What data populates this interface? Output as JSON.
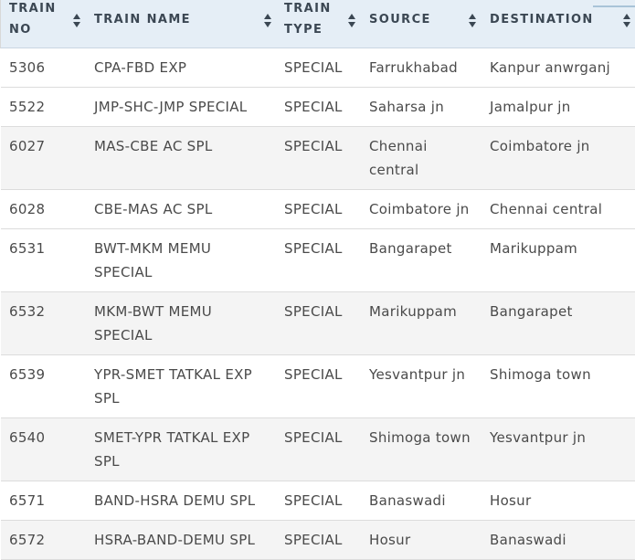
{
  "columns": [
    {
      "label_line1": "TRAIN",
      "label_line2": "NO"
    },
    {
      "label_line1": "TRAIN NAME",
      "label_line2": ""
    },
    {
      "label_line1": "TRAIN",
      "label_line2": "TYPE"
    },
    {
      "label_line1": "SOURCE",
      "label_line2": ""
    },
    {
      "label_line1": "DESTINATION",
      "label_line2": ""
    }
  ],
  "rows": [
    {
      "no": "5306",
      "name": "CPA-FBD EXP",
      "type": "SPECIAL",
      "source": "Farrukhabad",
      "destination": "Kanpur anwrganj"
    },
    {
      "no": "5522",
      "name": "JMP-SHC-JMP SPECIAL",
      "type": "SPECIAL",
      "source": "Saharsa jn",
      "destination": "Jamalpur jn"
    },
    {
      "no": "6027",
      "name": "MAS-CBE AC SPL",
      "type": "SPECIAL",
      "source": "Chennai central",
      "destination": "Coimbatore jn"
    },
    {
      "no": "6028",
      "name": "CBE-MAS AC SPL",
      "type": "SPECIAL",
      "source": "Coimbatore jn",
      "destination": "Chennai central"
    },
    {
      "no": "6531",
      "name": "BWT-MKM MEMU SPECIAL",
      "type": "SPECIAL",
      "source": "Bangarapet",
      "destination": "Marikuppam"
    },
    {
      "no": "6532",
      "name": "MKM-BWT MEMU SPECIAL",
      "type": "SPECIAL",
      "source": "Marikuppam",
      "destination": "Bangarapet"
    },
    {
      "no": "6539",
      "name": "YPR-SMET TATKAL EXP SPL",
      "type": "SPECIAL",
      "source": "Yesvantpur jn",
      "destination": "Shimoga town"
    },
    {
      "no": "6540",
      "name": "SMET-YPR TATKAL EXP SPL",
      "type": "SPECIAL",
      "source": "Shimoga town",
      "destination": "Yesvantpur jn"
    },
    {
      "no": "6571",
      "name": "BAND-HSRA DEMU SPL",
      "type": "SPECIAL",
      "source": "Banaswadi",
      "destination": "Hosur"
    },
    {
      "no": "6572",
      "name": "HSRA-BAND-DEMU SPL",
      "type": "SPECIAL",
      "source": "Hosur",
      "destination": "Banaswadi"
    }
  ]
}
